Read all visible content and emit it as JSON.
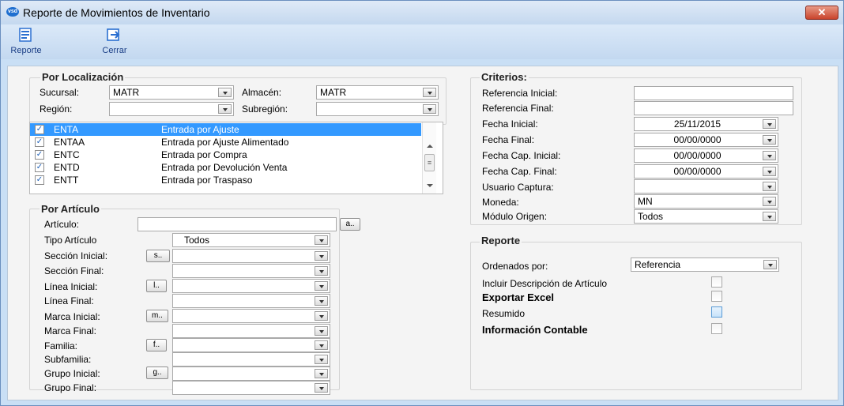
{
  "window": {
    "title": "Reporte de Movimientos de Inventario",
    "close": "✕",
    "app_icon_text": "vsd"
  },
  "toolbar": {
    "reporte": "Reporte",
    "cerrar": "Cerrar"
  },
  "localizacion": {
    "title": "Por Localización",
    "sucursal_label": "Sucursal:",
    "sucursal_value": "MATR",
    "almacen_label": "Almacén:",
    "almacen_value": "MATR",
    "region_label": "Región:",
    "region_value": "",
    "subregion_label": "Subregión:",
    "subregion_value": ""
  },
  "movements": [
    {
      "checked": true,
      "code": "ENTA",
      "desc": "Entrada por Ajuste",
      "selected": true
    },
    {
      "checked": true,
      "code": "ENTAA",
      "desc": "Entrada por Ajuste Alimentado",
      "selected": false
    },
    {
      "checked": true,
      "code": "ENTC",
      "desc": "Entrada por Compra",
      "selected": false
    },
    {
      "checked": true,
      "code": "ENTD",
      "desc": "Entrada por Devolución Venta",
      "selected": false
    },
    {
      "checked": true,
      "code": "ENTT",
      "desc": "Entrada por Traspaso",
      "selected": false
    }
  ],
  "articulo": {
    "title": "Por Artículo",
    "articulo_label": "Artículo:",
    "articulo_btn": "a..",
    "articulo_value": "",
    "tipo_label": "Tipo Artículo",
    "tipo_value": "Todos",
    "seccion_inicial_label": "Sección Inicial:",
    "seccion_btn": "s..",
    "seccion_final_label": "Sección Final:",
    "linea_inicial_label": "Línea Inicial:",
    "linea_btn": "l..",
    "linea_final_label": "Línea Final:",
    "marca_inicial_label": "Marca Inicial:",
    "marca_btn": "m..",
    "marca_final_label": "Marca Final:",
    "familia_label": "Familia:",
    "familia_btn": "f..",
    "subfamilia_label": "Subfamilia:",
    "grupo_inicial_label": "Grupo Inicial:",
    "grupo_btn": "g..",
    "grupo_final_label": "Grupo Final:"
  },
  "criterios": {
    "title": "Criterios:",
    "ref_ini_label": "Referencia Inicial:",
    "ref_ini_value": "",
    "ref_fin_label": "Referencia Final:",
    "ref_fin_value": "",
    "fecha_ini_label": "Fecha Inicial:",
    "fecha_ini_value": "25/11/2015",
    "fecha_fin_label": "Fecha Final:",
    "fecha_fin_value": "00/00/0000",
    "fcap_ini_label": "Fecha Cap. Inicial:",
    "fcap_ini_value": "00/00/0000",
    "fcap_fin_label": "Fecha Cap. Final:",
    "fcap_fin_value": "00/00/0000",
    "usuario_label": "Usuario Captura:",
    "usuario_value": "",
    "moneda_label": "Moneda:",
    "moneda_value": "MN",
    "modulo_label": "Módulo Origen:",
    "modulo_value": "Todos"
  },
  "reporte": {
    "title": "Reporte",
    "ordenados_label": "Ordenados por:",
    "ordenados_value": "Referencia",
    "incluir_label": "Incluir  Descripción de Artículo",
    "exportar_label": "Exportar Excel",
    "resumido_label": "Resumido",
    "contable_label": "Información Contable"
  }
}
